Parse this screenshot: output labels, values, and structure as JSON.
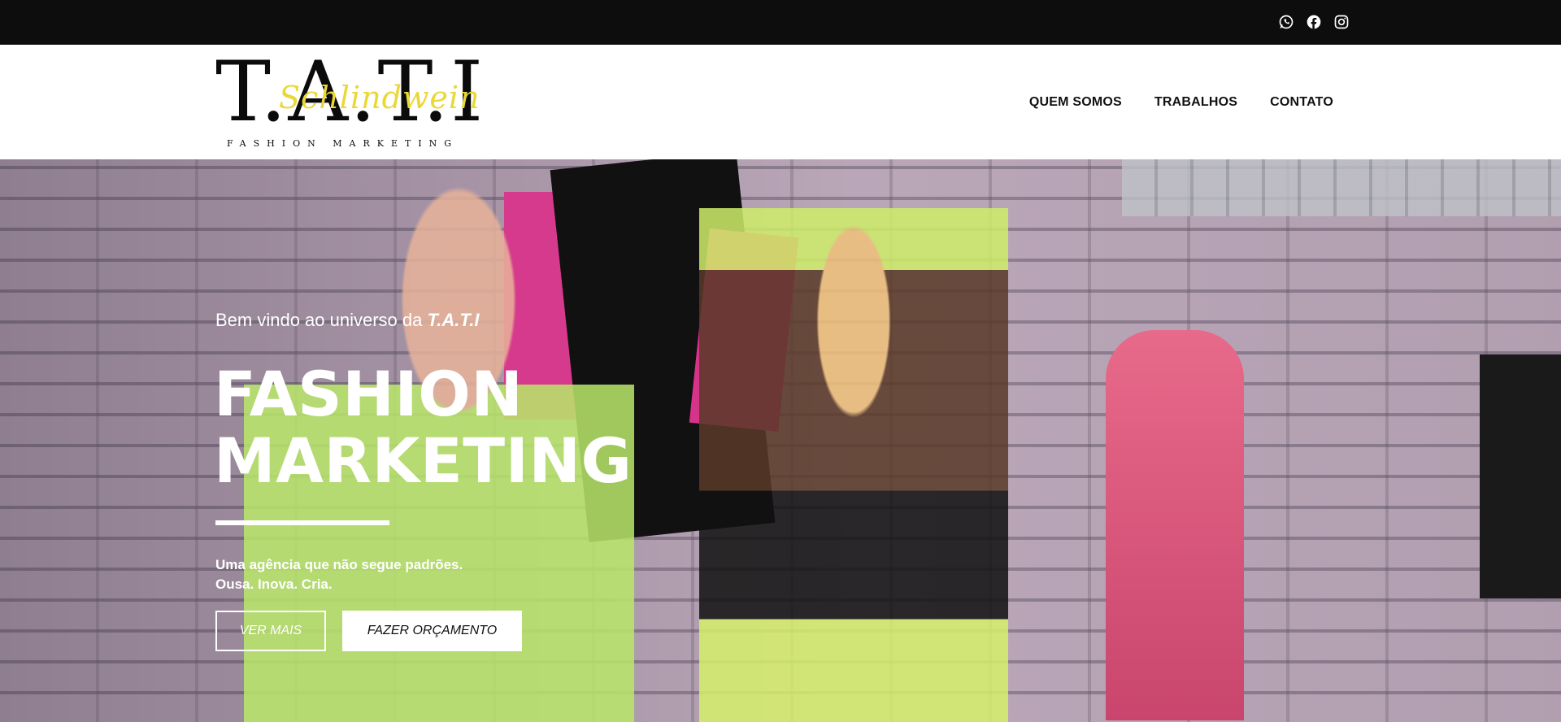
{
  "topbar": {
    "social": [
      {
        "icon": "whatsapp-icon",
        "name": "WhatsApp"
      },
      {
        "icon": "facebook-icon",
        "name": "Facebook"
      },
      {
        "icon": "instagram-icon",
        "name": "Instagram"
      }
    ]
  },
  "header": {
    "logo": {
      "main": "T.A.T.I",
      "script": "Schlindwein",
      "sub": "FASHION MARKETING"
    },
    "nav": [
      "QUEM SOMOS",
      "TRABALHOS",
      "CONTATO"
    ]
  },
  "hero": {
    "welcome_prefix": "Bem vindo ao universo da ",
    "welcome_brand": "T.A.T.I",
    "title_line1": "FASHION",
    "title_line2": "MARKETING",
    "tagline_line1": "Uma agência que não segue padrões.",
    "tagline_line2": "Ousa. Inova. Cria.",
    "buttons": {
      "primary": "VER MAIS",
      "secondary": "FAZER ORÇAMENTO"
    }
  },
  "colors": {
    "topbar": "#0d0d0d",
    "header_bg": "#ffffff",
    "logo_script": "#e9d835",
    "hero_text": "#ffffff"
  }
}
